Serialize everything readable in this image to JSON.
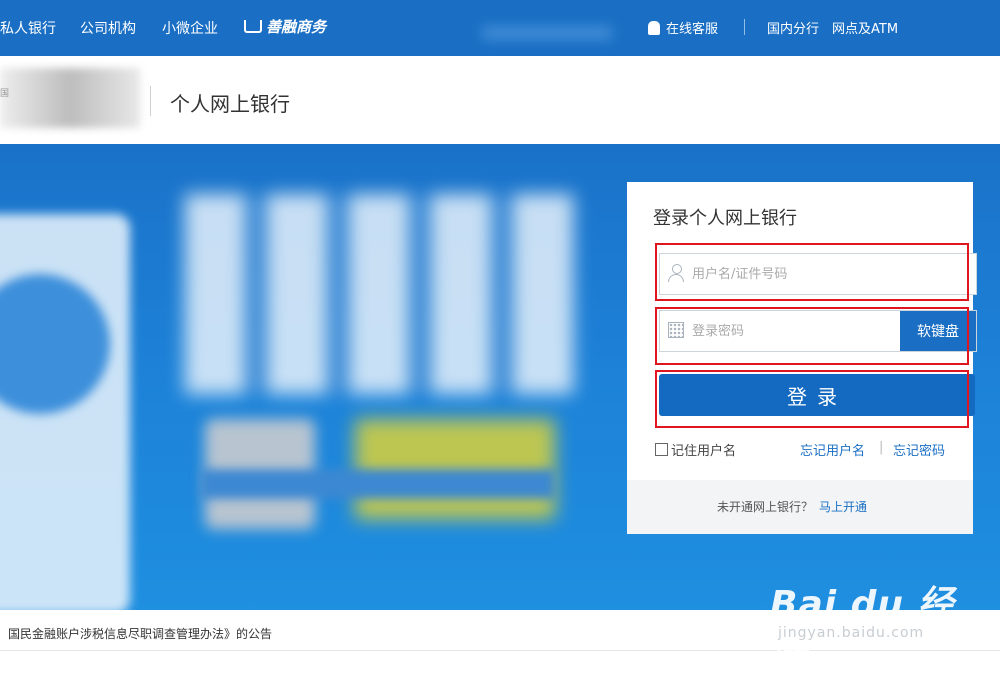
{
  "topbar": {
    "nav": [
      "私人银行",
      "公司机构",
      "小微企业"
    ],
    "shop": "善融商务",
    "service": "在线客服",
    "separator": "|",
    "branch": "国内分行",
    "atm": "网点及ATM"
  },
  "header": {
    "logo_text": "国",
    "title": "个人网上银行"
  },
  "login": {
    "title": "登录个人网上银行",
    "username_placeholder": "用户名/证件号码",
    "password_placeholder": "登录密码",
    "soft_keyboard": "软键盘",
    "submit": "登录",
    "remember": "记住用户名",
    "forgot_user": "忘记用户名",
    "link_sep": "|",
    "forgot_password": "忘记密码",
    "footer_text": "未开通网上银行？",
    "footer_link": "马上开通"
  },
  "announcement": "国民金融账户涉税信息尽职调查管理办法》的公告",
  "watermark": {
    "logo": "Bai  du 经验",
    "sub": "jingyan.baidu.com"
  },
  "colors": {
    "primary_blue": "#1a6fc4",
    "highlight_red": "#e0151f",
    "button_blue": "#1469c0"
  }
}
